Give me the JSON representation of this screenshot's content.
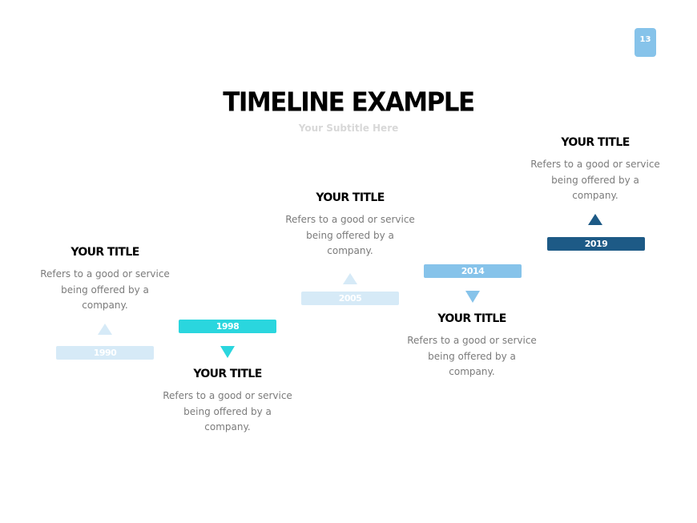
{
  "page_number": "13",
  "title": "TIMELINE EXAMPLE",
  "subtitle": "Your Subtitle Here",
  "colors": {
    "badge": "#86c3ea",
    "c1990": "#d6eaf7",
    "c1998": "#2ad6de",
    "c2005": "#d6eaf7",
    "c2014": "#86c3ea",
    "c2019": "#1d5a86"
  },
  "milestones": [
    {
      "year": "1990",
      "title": "YOUR TITLE",
      "desc": "Refers to a good or service being offered by a company."
    },
    {
      "year": "1998",
      "title": "YOUR TITLE",
      "desc": "Refers to a good or service being offered by a company."
    },
    {
      "year": "2005",
      "title": "YOUR TITLE",
      "desc": "Refers to a good or service being offered by a company."
    },
    {
      "year": "2014",
      "title": "YOUR TITLE",
      "desc": "Refers to a good or service being offered by a company."
    },
    {
      "year": "2019",
      "title": "YOUR TITLE",
      "desc": "Refers to a good or service being offered by a company."
    }
  ]
}
